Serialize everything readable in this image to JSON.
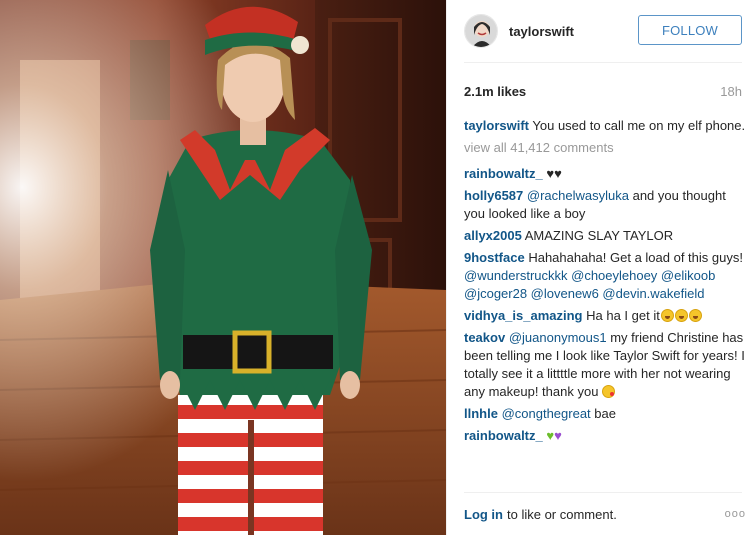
{
  "post": {
    "author": "taylorswift",
    "follow_label": "FOLLOW",
    "likes": "2.1m likes",
    "time_ago": "18h",
    "caption_user": "taylorswift",
    "caption_text": "You used to call me on my elf phone.",
    "view_all": "view all 41,412 comments"
  },
  "comments": [
    {
      "user": "rainbowaltz_",
      "text": "♥♥"
    },
    {
      "user": "holly6587",
      "mention": "@rachelwasyluka",
      "text": "and you thought you looked like a boy"
    },
    {
      "user": "allyx2005",
      "text": "AMAZING SLAY TAYLOR"
    },
    {
      "user": "9hostface",
      "text": "Hahahahaha! Get a load of this guys!",
      "mentions": "@wunderstruckkk @choeylehoey @elikoob @jcoger28 @lovenew6 @devin.wakefield"
    },
    {
      "user": "vidhya_is_amazing",
      "text": "Ha ha I get it"
    },
    {
      "user": "teakov",
      "mention": "@juanonymous1",
      "text": "my friend Christine has been telling me I look like Taylor Swift for years! I totally see it a littttle more with her not wearing any makeup! thank you"
    },
    {
      "user": "llnhle",
      "mention": "@congthegreat",
      "text": "bae"
    },
    {
      "user": "rainbowaltz_",
      "text": ""
    }
  ],
  "footer": {
    "login_link": "Log in",
    "login_rest": "to like or comment.",
    "more": "ooo"
  },
  "icons": {
    "heart_green": "green-heart-icon",
    "heart_purple": "purple-heart-icon",
    "laugh": "tears-of-joy-icon",
    "wink": "kiss-icon",
    "more": "more-options-icon"
  },
  "colors": {
    "link": "#125688",
    "follow_border": "#5b95c8",
    "muted": "#999999"
  }
}
